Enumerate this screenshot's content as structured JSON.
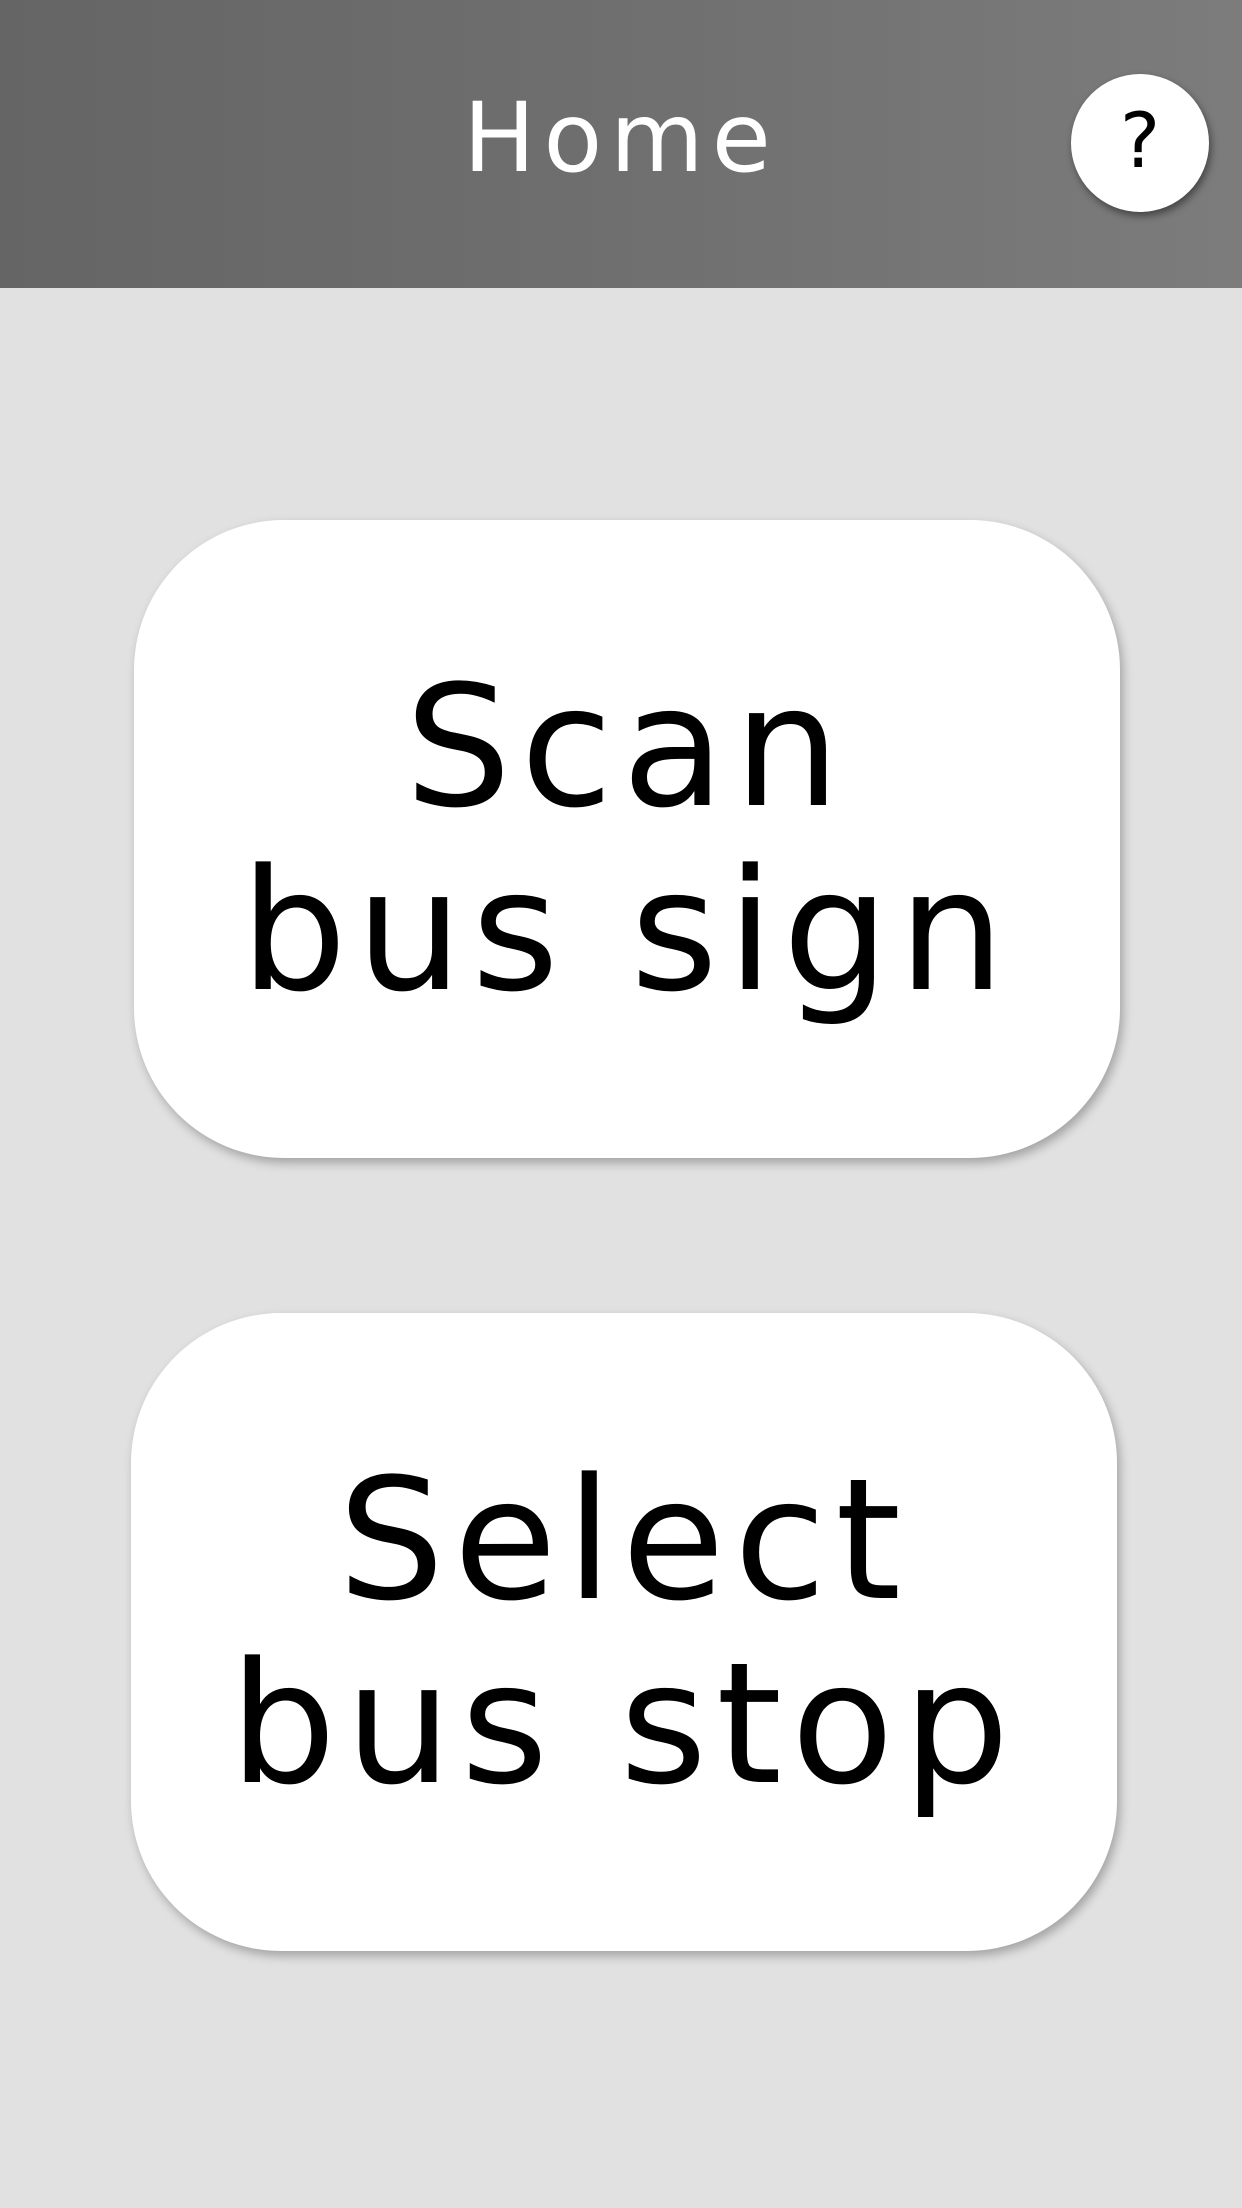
{
  "header": {
    "title": "Home",
    "help_label": "?",
    "background_color": "#6f6f6f"
  },
  "buttons": [
    {
      "line1": "Scan",
      "line2": "bus sign"
    },
    {
      "line1": "Select",
      "line2": "bus stop"
    }
  ],
  "colors": {
    "page_background": "#e1e1e1",
    "button_background": "#ffffff",
    "text": "#000000"
  }
}
